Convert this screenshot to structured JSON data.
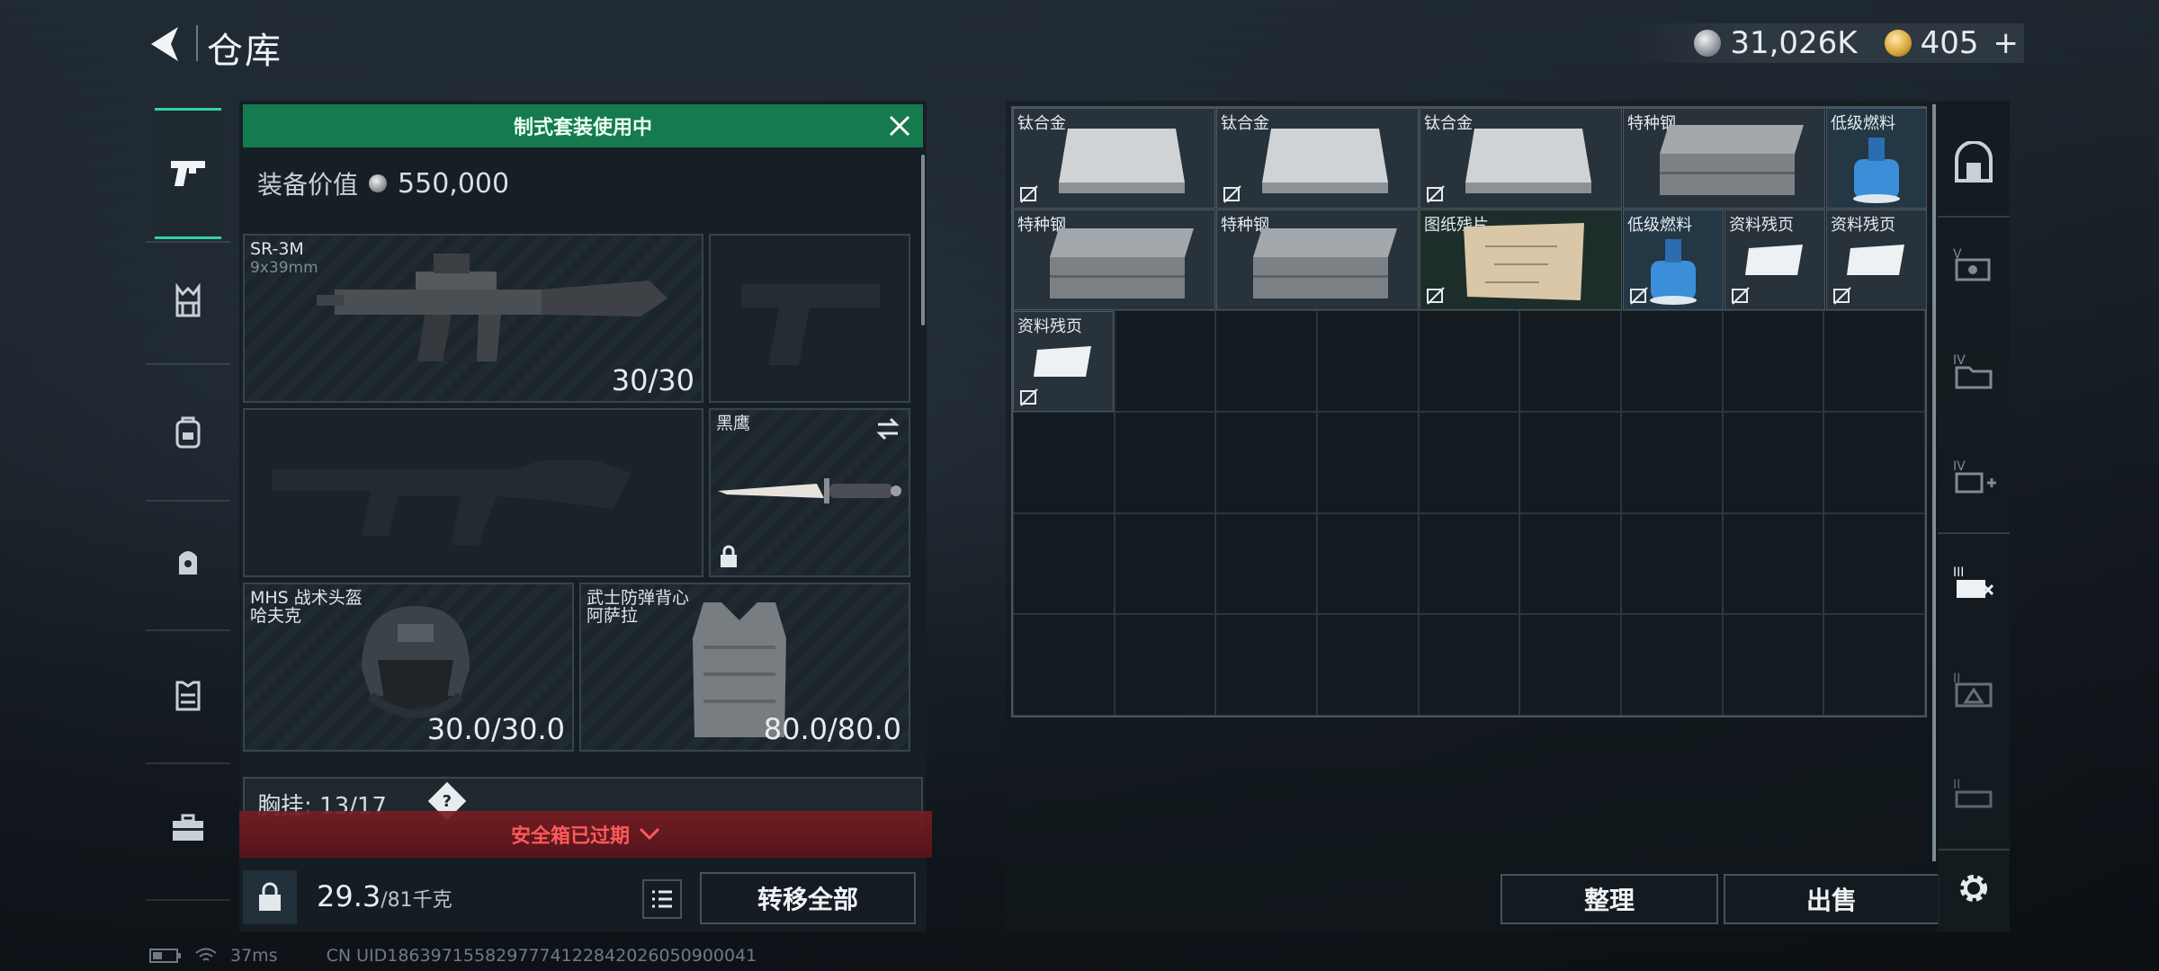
{
  "header": {
    "title": "仓库",
    "currency": {
      "silver_amount": "31,026K",
      "gold_amount": "405",
      "plus": "+"
    }
  },
  "loadout": {
    "banner": "制式套装使用中",
    "gear_value_label": "装备价值",
    "gear_value": "550,000",
    "primary": {
      "name": "SR-3M",
      "caliber": "9x39mm",
      "ammo": "30/30"
    },
    "melee": {
      "name": "黑鹰"
    },
    "helmet": {
      "name": "MHS 战术头盔",
      "sub": "哈夫克",
      "durability": "30.0/30.0"
    },
    "armor": {
      "name": "武士防弹背心",
      "sub": "阿萨拉",
      "durability": "80.0/80.0"
    },
    "chest_rig": {
      "label": "胸挂:",
      "capacity": "13/17",
      "help": "?"
    },
    "expired_notice": "安全箱已过期",
    "weight": {
      "current": "29.3",
      "max": "/81",
      "unit": "千克"
    },
    "transfer_all": "转移全部"
  },
  "stash": {
    "items": [
      {
        "name": "钛合金"
      },
      {
        "name": "钛合金"
      },
      {
        "name": "钛合金"
      },
      {
        "name": "特种钢"
      },
      {
        "name": "低级燃料"
      },
      {
        "name": "特种钢"
      },
      {
        "name": "特种钢"
      },
      {
        "name": "图纸残片"
      },
      {
        "name": "低级燃料"
      },
      {
        "name": "资料残页"
      },
      {
        "name": "资料残页"
      },
      {
        "name": "资料残页"
      }
    ],
    "sort_button": "整理",
    "sell_button": "出售"
  },
  "status_bar": {
    "ping": "37ms",
    "uid": "CN UID1863971558297774122842026050900041"
  },
  "colors": {
    "accent": "#2fd3a2",
    "banner": "#157a4e",
    "warning": "#ff5a5a"
  }
}
